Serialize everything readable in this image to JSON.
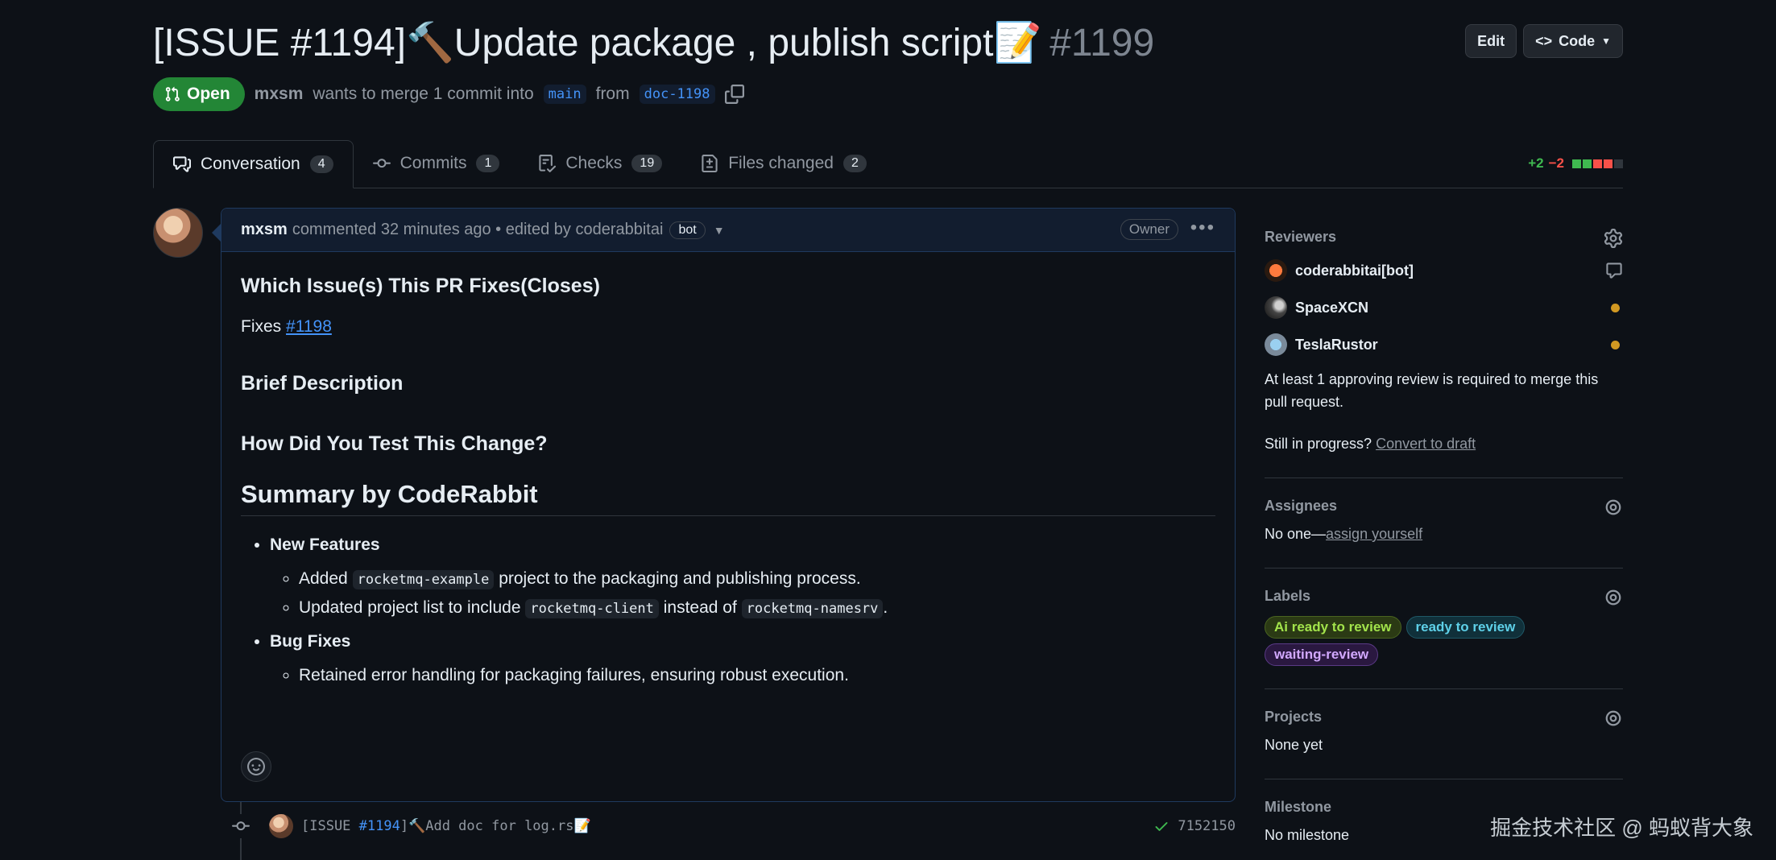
{
  "header": {
    "title": "[ISSUE #1194]🔨Update package , publish script📝",
    "number": "#1199",
    "edit_label": "Edit",
    "code_label": "Code"
  },
  "pr_meta": {
    "state": "Open",
    "author": "mxsm",
    "merge_text": "wants to merge 1 commit into",
    "base_branch": "main",
    "from_text": "from",
    "head_branch": "doc-1198"
  },
  "tabs": [
    {
      "label": "Conversation",
      "count": "4"
    },
    {
      "label": "Commits",
      "count": "1"
    },
    {
      "label": "Checks",
      "count": "19"
    },
    {
      "label": "Files changed",
      "count": "2"
    }
  ],
  "diffstat": {
    "additions": "+2",
    "deletions": "−2"
  },
  "comment": {
    "author": "mxsm",
    "meta": "commented 32 minutes ago • edited by coderabbitai",
    "bot_badge": "bot",
    "owner_badge": "Owner",
    "h_fixes": "Which Issue(s) This PR Fixes(Closes)",
    "fixes_prefix": "Fixes",
    "fixes_link": "#1198",
    "h_brief": "Brief Description",
    "h_test": "How Did You Test This Change?",
    "h_summary": "Summary by CodeRabbit",
    "new_features": "New Features",
    "nf1_a": "Added",
    "nf1_code": "rocketmq-example",
    "nf1_b": "project to the packaging and publishing process.",
    "nf2_a": "Updated project list to include",
    "nf2_code1": "rocketmq-client",
    "nf2_b": "instead of",
    "nf2_code2": "rocketmq-namesrv",
    "nf2_c": ".",
    "bug_fixes": "Bug Fixes",
    "bf1": "Retained error handling for packaging failures, ensuring robust execution."
  },
  "commit": {
    "msg_prefix": "[ISSUE ",
    "msg_link": "#1194",
    "msg_suffix": "]🔨Add doc for log.rs📝",
    "sha": "7152150"
  },
  "sidebar": {
    "reviewers_title": "Reviewers",
    "reviewers": [
      "coderabbitai[bot]",
      "SpaceXCN",
      "TeslaRustor"
    ],
    "review_note": "At least 1 approving review is required to merge this pull request.",
    "progress_text": "Still in progress?",
    "draft_link": "Convert to draft",
    "assignees_title": "Assignees",
    "assignees_text": "No one—",
    "assign_link": "assign yourself",
    "labels_title": "Labels",
    "labels": [
      {
        "name": "Ai ready to review",
        "color": "#a2e34b"
      },
      {
        "name": "ready to review",
        "color": "#5ed0e8"
      },
      {
        "name": "waiting-review",
        "color": "#d2a8ff"
      }
    ],
    "projects_title": "Projects",
    "projects_text": "None yet",
    "milestone_title": "Milestone",
    "milestone_text": "No milestone"
  },
  "watermark": "掘金技术社区 @ 蚂蚁背大象"
}
